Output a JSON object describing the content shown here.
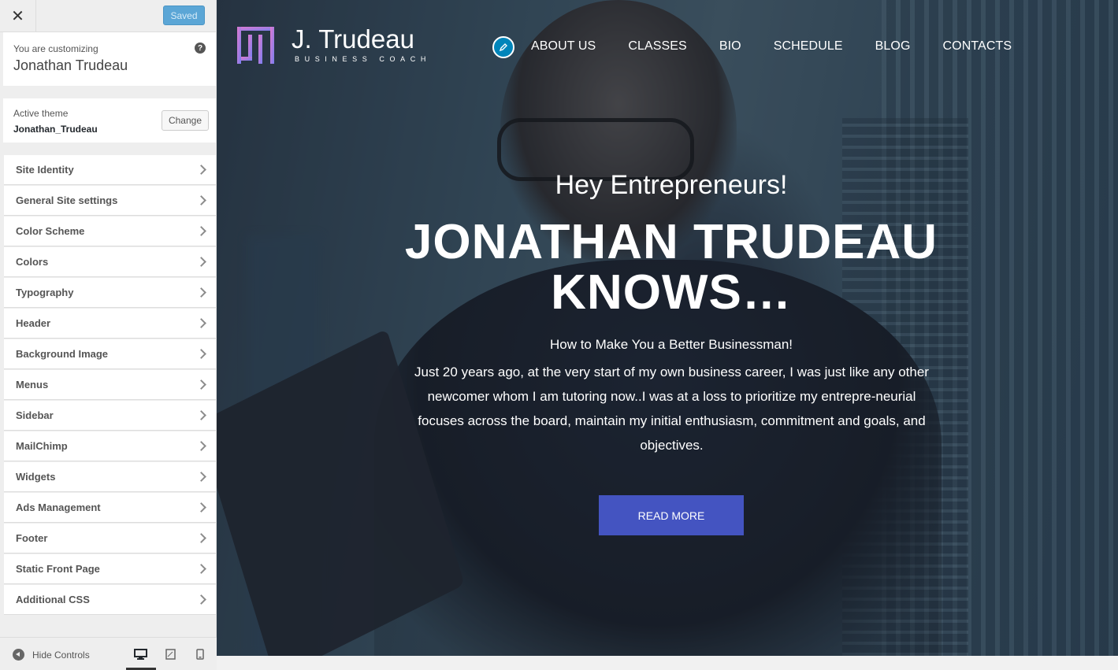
{
  "sidebar": {
    "close_icon": "close-icon",
    "save_button": "Saved",
    "customizing_label": "You are customizing",
    "site_name": "Jonathan Trudeau",
    "help_icon": "?",
    "active_theme_label": "Active theme",
    "active_theme_name": "Jonathan_Trudeau",
    "change_button": "Change",
    "sections": [
      {
        "label": "Site Identity"
      },
      {
        "label": "General Site settings"
      },
      {
        "label": "Color Scheme"
      },
      {
        "label": "Colors"
      },
      {
        "label": "Typography"
      },
      {
        "label": "Header"
      },
      {
        "label": "Background Image"
      },
      {
        "label": "Menus"
      },
      {
        "label": "Sidebar"
      },
      {
        "label": "MailChimp"
      },
      {
        "label": "Widgets"
      },
      {
        "label": "Ads Management"
      },
      {
        "label": "Footer"
      },
      {
        "label": "Static Front Page"
      },
      {
        "label": "Additional CSS"
      }
    ],
    "footer": {
      "hide_controls": "Hide Controls",
      "devices": [
        "desktop-icon",
        "tablet-icon",
        "mobile-icon"
      ],
      "selected_device": "desktop"
    }
  },
  "preview": {
    "logo": {
      "name": "J. Trudeau",
      "subtitle": "BUSINESS COACH"
    },
    "nav": [
      {
        "label": "ABOUT US"
      },
      {
        "label": "CLASSES"
      },
      {
        "label": "BIO"
      },
      {
        "label": "SCHEDULE"
      },
      {
        "label": "BLOG"
      },
      {
        "label": "CONTACTS"
      }
    ],
    "hero": {
      "greeting": "Hey Entrepreneurs!",
      "title_line1": "JONATHAN TRUDEAU",
      "title_line2": "KNOWS…",
      "subtitle": "How to Make You a Better Businessman!",
      "paragraph": "Just 20 years ago, at the very start of my own business career, I was just like any other newcomer whom I am tutoring now..I was at a loss to prioritize my entrepre-neurial focuses across the board, maintain my initial enthusiasm, commitment and goals, and objectives.",
      "cta": "READ MORE"
    }
  },
  "colors": {
    "saved_button": "#5ba6d6",
    "cta_button": "#4454c1",
    "edit_shortcut": "#0085ba"
  }
}
